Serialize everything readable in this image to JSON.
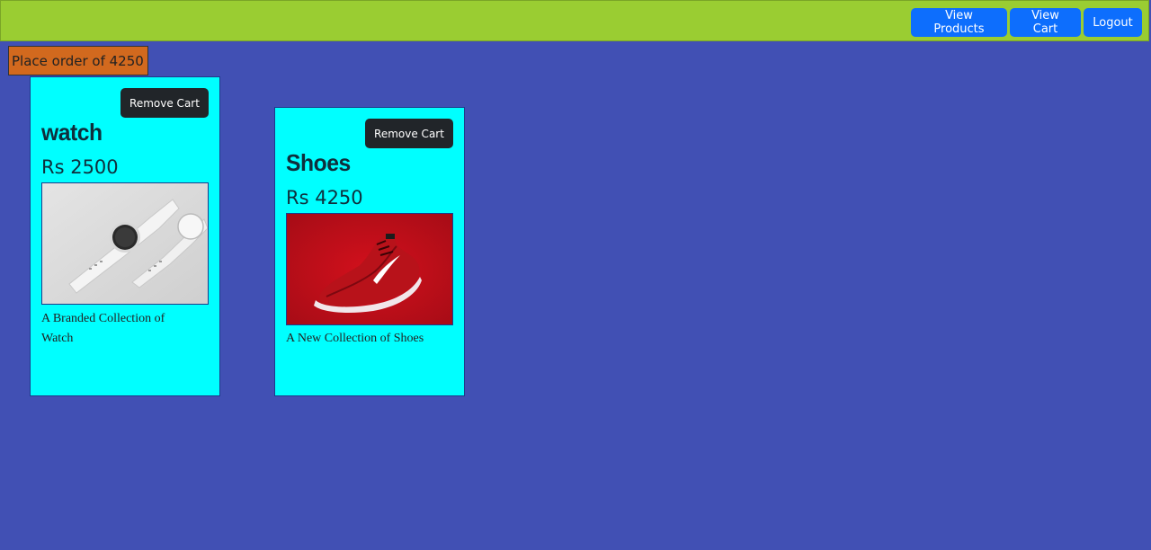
{
  "nav": {
    "view_products": "View Products",
    "view_cart": "View Cart",
    "logout": "Logout"
  },
  "order": {
    "label": "Place order of 4250"
  },
  "cart_items": [
    {
      "remove_label": "Remove Cart",
      "name": "watch",
      "price": "Rs 2500",
      "description": "A Branded Collection of Watch",
      "image": "watch-photo"
    },
    {
      "remove_label": "Remove Cart",
      "name": "Shoes",
      "price": "Rs 4250",
      "description": "A New Collection of Shoes",
      "image": "shoe-photo"
    }
  ],
  "colors": {
    "page_bg": "#4150b4",
    "navbar_bg": "#9acd32",
    "primary_button": "#0d6efd",
    "order_button": "#d2691e",
    "card_bg": "#00ffff",
    "dark_button": "#212529"
  }
}
